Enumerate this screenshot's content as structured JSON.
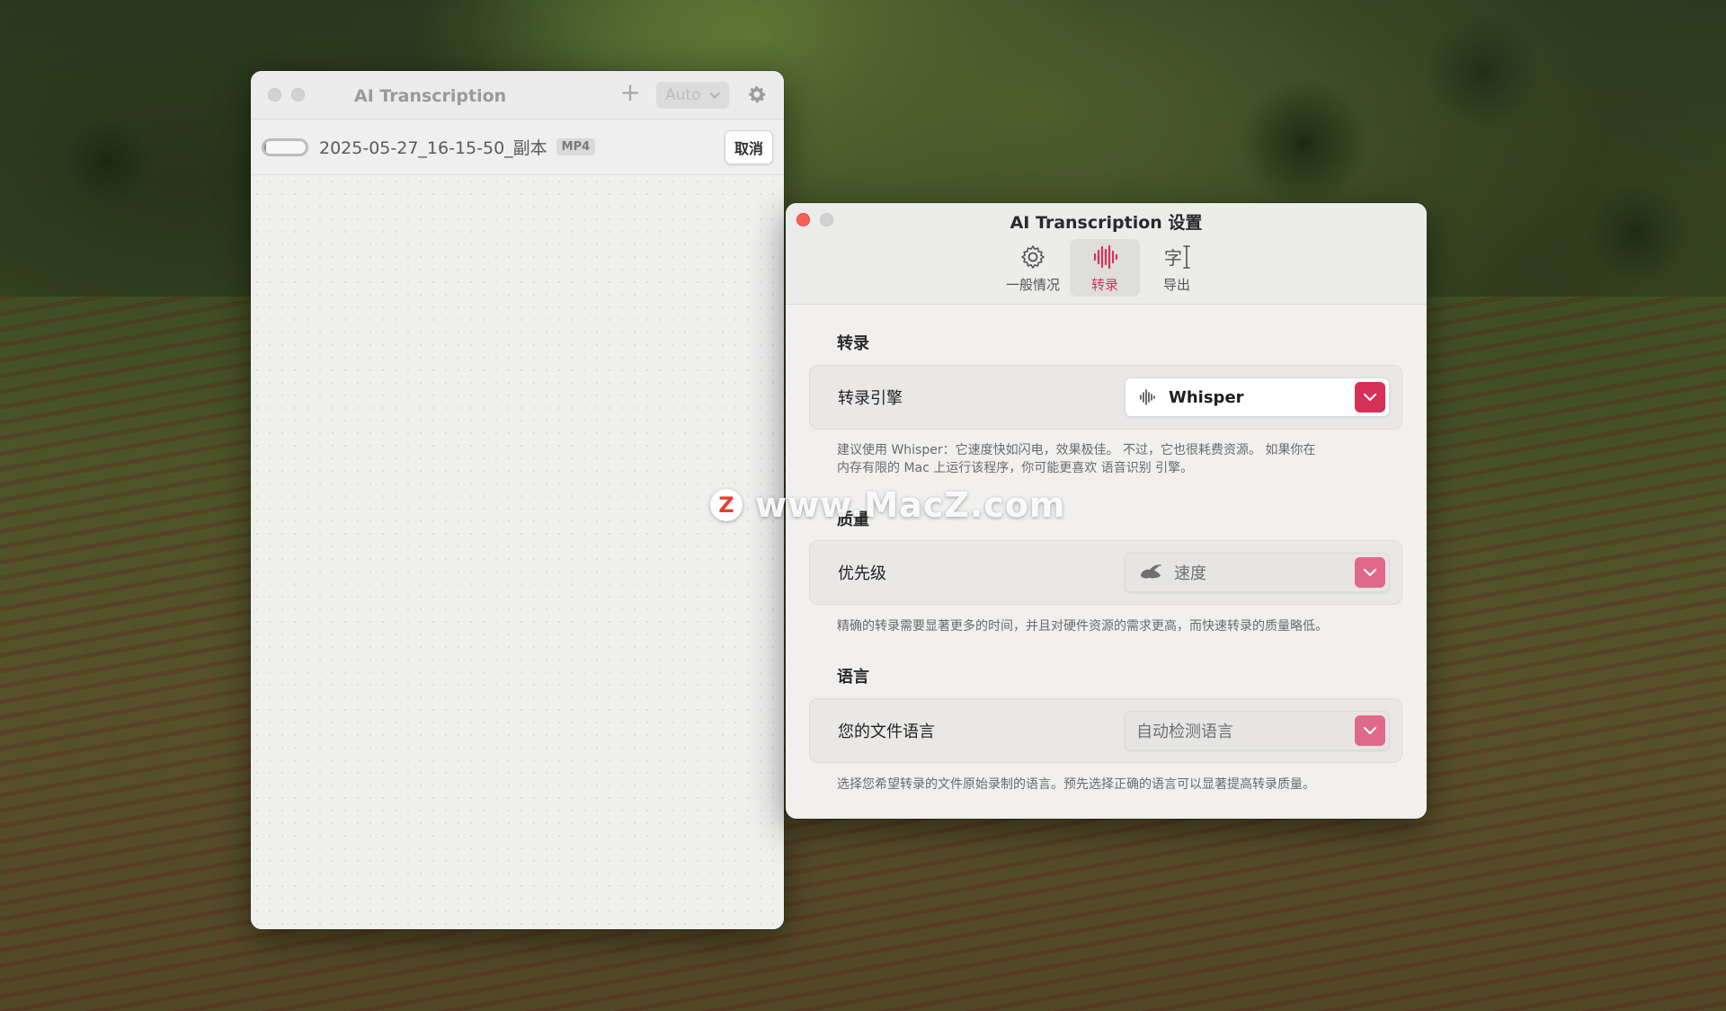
{
  "main_window": {
    "title": "AI Transcription",
    "add_label": "+",
    "language_select": "Auto",
    "file": {
      "name": "2025-05-27_16-15-50_副本",
      "badge": "MP4",
      "progress": 0.05,
      "cancel_label": "取消"
    }
  },
  "settings_window": {
    "title": "AI Transcription 设置",
    "tabs": [
      {
        "label": "一般情况",
        "icon": "gear-icon"
      },
      {
        "label": "转录",
        "icon": "waveform-icon",
        "active": true
      },
      {
        "label": "导出",
        "icon": "text-cursor-icon"
      }
    ],
    "sections": {
      "transcription": {
        "heading": "转录",
        "row_label": "转录引擎",
        "value": "Whisper",
        "help_line1": "建议使用 Whisper：它速度快如闪电，效果极佳。 不过，它也很耗费资源。 如果你在",
        "help_line2": "内存有限的 Mac 上运行该程序，你可能更喜欢 语音识别 引擎。"
      },
      "quality": {
        "heading": "质量",
        "row_label": "优先级",
        "value": "速度",
        "help": "精确的转录需要显著更多的时间，并且对硬件资源的需求更高，而快速转录的质量略低。"
      },
      "language": {
        "heading": "语言",
        "row_label": "您的文件语言",
        "value": "自动检测语言",
        "help": "选择您希望转录的文件原始录制的语言。预先选择正确的语言可以显著提高转录质量。"
      }
    }
  },
  "watermark": {
    "logo": "Z",
    "text": "www.MacZ.com"
  },
  "colors": {
    "accent": "#d62f58",
    "window_bg": "#f1f0ef"
  }
}
